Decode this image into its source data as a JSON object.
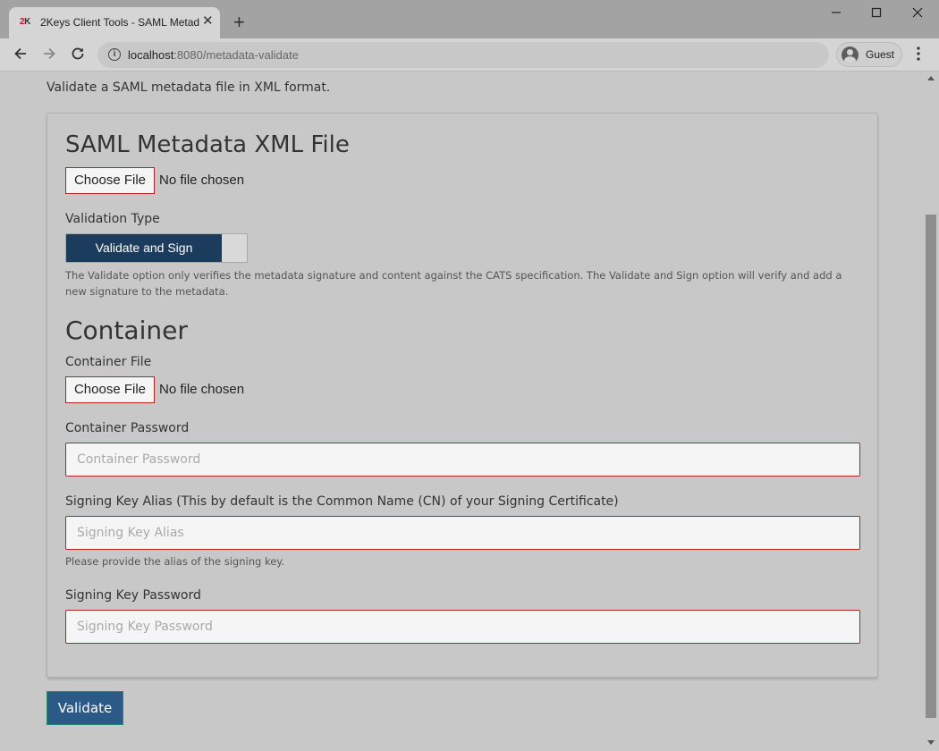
{
  "browser": {
    "tab_logo_red": "2",
    "tab_logo_dark": "K",
    "tab_title": "2Keys Client Tools - SAML Metad",
    "tab_close": "✕",
    "new_tab": "+",
    "url_host": "localhost",
    "url_path": ":8080/metadata-validate",
    "profile_label": "Guest"
  },
  "page": {
    "intro": "Validate a SAML metadata file in XML format."
  },
  "metadata_section": {
    "title": "SAML Metadata XML File",
    "file_button": "Choose File",
    "file_status": "No file chosen",
    "validation_type_label": "Validation Type",
    "validation_type_selected": "Validate and Sign",
    "validation_help": "The Validate option only verifies the metadata signature and content against the CATS specification. The Validate and Sign option will verify and add a new signature to the metadata."
  },
  "container_section": {
    "title": "Container",
    "file_label": "Container File",
    "file_button": "Choose File",
    "file_status": "No file chosen",
    "password_label": "Container Password",
    "password_placeholder": "Container Password",
    "alias_label": "Signing Key Alias (This by default is the Common Name (CN) of your Signing Certificate)",
    "alias_placeholder": "Signing Key Alias",
    "alias_help": "Please provide the alias of the signing key.",
    "key_password_label": "Signing Key Password",
    "key_password_placeholder": "Signing Key Password"
  },
  "actions": {
    "submit_label": "Validate"
  },
  "colors": {
    "toggle_active": "#1c3c5e",
    "submit_button": "#2c5a88",
    "input_border": "#b32424",
    "logo_red": "#c8102e"
  },
  "icons": {
    "back": "back-arrow-icon",
    "forward": "forward-arrow-icon",
    "reload": "reload-icon",
    "info": "info-icon",
    "profile": "guest-avatar-icon",
    "menu": "kebab-menu-icon"
  }
}
